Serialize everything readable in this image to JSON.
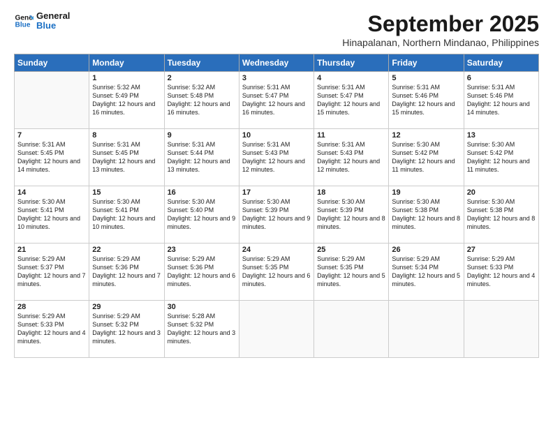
{
  "header": {
    "logo_line1": "General",
    "logo_line2": "Blue",
    "month": "September 2025",
    "location": "Hinapalanan, Northern Mindanao, Philippines"
  },
  "days_of_week": [
    "Sunday",
    "Monday",
    "Tuesday",
    "Wednesday",
    "Thursday",
    "Friday",
    "Saturday"
  ],
  "weeks": [
    [
      {
        "day": "",
        "empty": true
      },
      {
        "day": "1",
        "sunrise": "5:32 AM",
        "sunset": "5:49 PM",
        "daylight": "12 hours and 16 minutes."
      },
      {
        "day": "2",
        "sunrise": "5:32 AM",
        "sunset": "5:48 PM",
        "daylight": "12 hours and 16 minutes."
      },
      {
        "day": "3",
        "sunrise": "5:31 AM",
        "sunset": "5:47 PM",
        "daylight": "12 hours and 16 minutes."
      },
      {
        "day": "4",
        "sunrise": "5:31 AM",
        "sunset": "5:47 PM",
        "daylight": "12 hours and 15 minutes."
      },
      {
        "day": "5",
        "sunrise": "5:31 AM",
        "sunset": "5:46 PM",
        "daylight": "12 hours and 15 minutes."
      },
      {
        "day": "6",
        "sunrise": "5:31 AM",
        "sunset": "5:46 PM",
        "daylight": "12 hours and 14 minutes."
      }
    ],
    [
      {
        "day": "7",
        "sunrise": "5:31 AM",
        "sunset": "5:45 PM",
        "daylight": "12 hours and 14 minutes."
      },
      {
        "day": "8",
        "sunrise": "5:31 AM",
        "sunset": "5:45 PM",
        "daylight": "12 hours and 13 minutes."
      },
      {
        "day": "9",
        "sunrise": "5:31 AM",
        "sunset": "5:44 PM",
        "daylight": "12 hours and 13 minutes."
      },
      {
        "day": "10",
        "sunrise": "5:31 AM",
        "sunset": "5:43 PM",
        "daylight": "12 hours and 12 minutes."
      },
      {
        "day": "11",
        "sunrise": "5:31 AM",
        "sunset": "5:43 PM",
        "daylight": "12 hours and 12 minutes."
      },
      {
        "day": "12",
        "sunrise": "5:30 AM",
        "sunset": "5:42 PM",
        "daylight": "12 hours and 11 minutes."
      },
      {
        "day": "13",
        "sunrise": "5:30 AM",
        "sunset": "5:42 PM",
        "daylight": "12 hours and 11 minutes."
      }
    ],
    [
      {
        "day": "14",
        "sunrise": "5:30 AM",
        "sunset": "5:41 PM",
        "daylight": "12 hours and 10 minutes."
      },
      {
        "day": "15",
        "sunrise": "5:30 AM",
        "sunset": "5:41 PM",
        "daylight": "12 hours and 10 minutes."
      },
      {
        "day": "16",
        "sunrise": "5:30 AM",
        "sunset": "5:40 PM",
        "daylight": "12 hours and 9 minutes."
      },
      {
        "day": "17",
        "sunrise": "5:30 AM",
        "sunset": "5:39 PM",
        "daylight": "12 hours and 9 minutes."
      },
      {
        "day": "18",
        "sunrise": "5:30 AM",
        "sunset": "5:39 PM",
        "daylight": "12 hours and 8 minutes."
      },
      {
        "day": "19",
        "sunrise": "5:30 AM",
        "sunset": "5:38 PM",
        "daylight": "12 hours and 8 minutes."
      },
      {
        "day": "20",
        "sunrise": "5:30 AM",
        "sunset": "5:38 PM",
        "daylight": "12 hours and 8 minutes."
      }
    ],
    [
      {
        "day": "21",
        "sunrise": "5:29 AM",
        "sunset": "5:37 PM",
        "daylight": "12 hours and 7 minutes."
      },
      {
        "day": "22",
        "sunrise": "5:29 AM",
        "sunset": "5:36 PM",
        "daylight": "12 hours and 7 minutes."
      },
      {
        "day": "23",
        "sunrise": "5:29 AM",
        "sunset": "5:36 PM",
        "daylight": "12 hours and 6 minutes."
      },
      {
        "day": "24",
        "sunrise": "5:29 AM",
        "sunset": "5:35 PM",
        "daylight": "12 hours and 6 minutes."
      },
      {
        "day": "25",
        "sunrise": "5:29 AM",
        "sunset": "5:35 PM",
        "daylight": "12 hours and 5 minutes."
      },
      {
        "day": "26",
        "sunrise": "5:29 AM",
        "sunset": "5:34 PM",
        "daylight": "12 hours and 5 minutes."
      },
      {
        "day": "27",
        "sunrise": "5:29 AM",
        "sunset": "5:33 PM",
        "daylight": "12 hours and 4 minutes."
      }
    ],
    [
      {
        "day": "28",
        "sunrise": "5:29 AM",
        "sunset": "5:33 PM",
        "daylight": "12 hours and 4 minutes."
      },
      {
        "day": "29",
        "sunrise": "5:29 AM",
        "sunset": "5:32 PM",
        "daylight": "12 hours and 3 minutes."
      },
      {
        "day": "30",
        "sunrise": "5:28 AM",
        "sunset": "5:32 PM",
        "daylight": "12 hours and 3 minutes."
      },
      {
        "day": "",
        "empty": true
      },
      {
        "day": "",
        "empty": true
      },
      {
        "day": "",
        "empty": true
      },
      {
        "day": "",
        "empty": true
      }
    ]
  ]
}
